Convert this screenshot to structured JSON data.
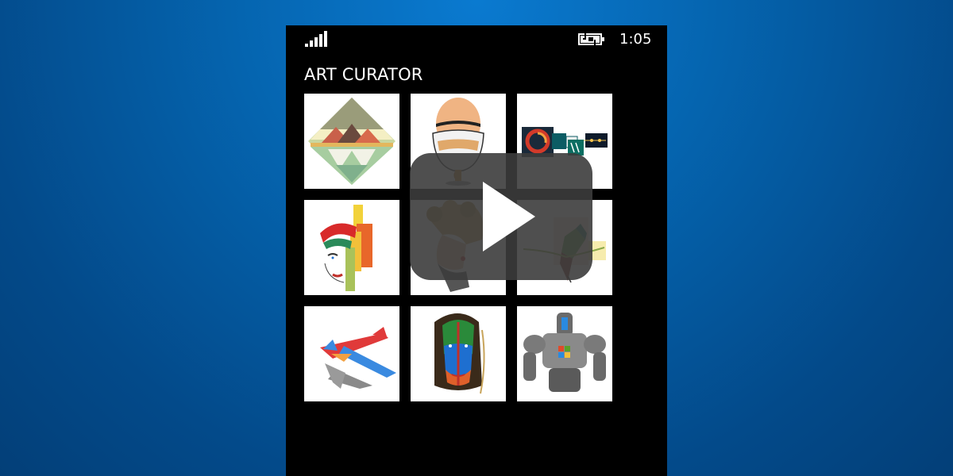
{
  "status_bar": {
    "signal_icon": "signal-strength-icon",
    "battery_icon": "battery-charging-icon",
    "time": "1:05"
  },
  "app": {
    "title": "ART CURATOR"
  },
  "gallery": {
    "tiles": [
      {
        "subject": "mountain-landscape-diamond"
      },
      {
        "subject": "cracked-egg-cup"
      },
      {
        "subject": "circuit-logo-collage"
      },
      {
        "subject": "colorful-face-abstract"
      },
      {
        "subject": "curly-hair-portrait"
      },
      {
        "subject": "geometric-bird"
      },
      {
        "subject": "origami-airplane"
      },
      {
        "subject": "split-color-woman-face"
      },
      {
        "subject": "robot-with-logo"
      }
    ]
  },
  "overlay": {
    "icon": "play-icon",
    "color": "#3c3c3c"
  }
}
